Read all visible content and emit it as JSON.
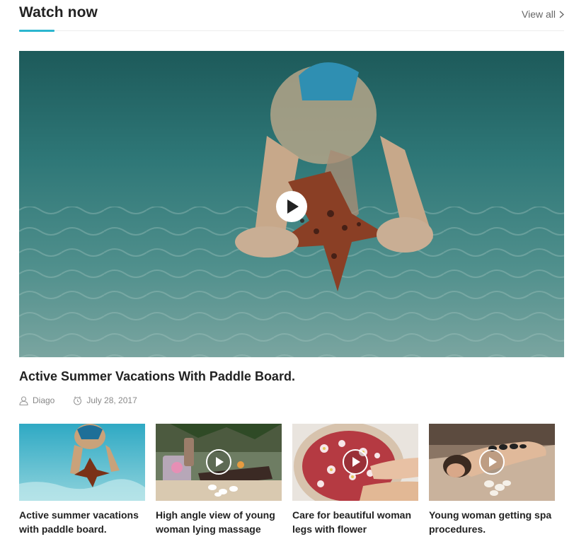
{
  "section": {
    "title": "Watch now",
    "view_all": "View all"
  },
  "featured": {
    "title": "Active Summer Vacations With Paddle Board.",
    "author": "Diago",
    "date": "July 28, 2017"
  },
  "cards": [
    {
      "title": "Active summer vacations with paddle board."
    },
    {
      "title": "High angle view of young woman lying massage"
    },
    {
      "title": "Care for beautiful woman legs with flower"
    },
    {
      "title": "Young woman getting spa procedures."
    }
  ],
  "colors": {
    "accent": "#2bb6cf",
    "text": "#222222",
    "meta": "#888888"
  }
}
